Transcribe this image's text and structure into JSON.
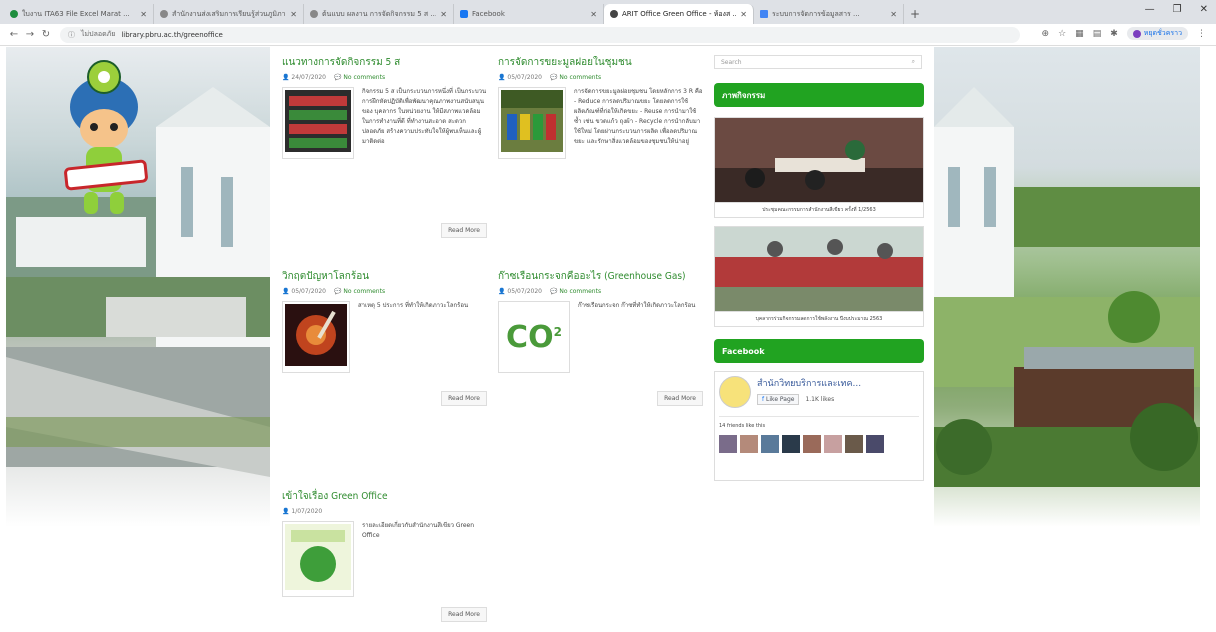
{
  "browser": {
    "tabs": [
      {
        "label": "ใบงาน ITA63 File Excel Marat ...",
        "active": false
      },
      {
        "label": "สำนักงานส่งเสริมการเรียนรู้ส่วนภูมิภาค ...",
        "active": false
      },
      {
        "label": "ต้นแบบ ผลงาน การจัดกิจกรรม 5 ส ...",
        "active": false
      },
      {
        "label": "Facebook",
        "active": false
      },
      {
        "label": "ARIT Office Green Office - ห้องส ...",
        "active": true
      },
      {
        "label": "ระบบการจัดการข้อมูลสาร ...",
        "active": false
      }
    ],
    "new_tab": "+",
    "url_site": "ไม่ปลอดภัย",
    "url": "library.pbru.ac.th/greenoffice",
    "profile": "หยุดชั่วคราว"
  },
  "posts": [
    {
      "title": "แนวทางการจัดกิจกรรม 5 ส",
      "date": "24/07/2020",
      "comments": "No comments",
      "excerpt": "กิจกรรม 5 ส เป็นกระบวนการหนึ่งที่ เป็นกระบวนการฝึกหัดปฏิบัติเพื่อพัฒนาคุณภาพงานสนับสนุนของ บุคลากร ในหน่วยงาน ให้มีสภาพแวดล้อมในการทำงานที่ดี ที่ทำงานสะอาด สะดวก ปลอดภัย สร้างความประทับใจให้ผู้พบเห็นและผู้มาติดต่อ",
      "read_more": "Read More"
    },
    {
      "title": "การจัดการขยะมูลฝอยในชุมชน",
      "date": "05/07/2020",
      "comments": "No comments",
      "excerpt": "การจัดการขยะมูลฝอยชุมชน โดยหลักการ 3 R คือ - Reduce การลดปริมาณขยะ โดยลดการใช้ผลิตภัณฑ์ที่ก่อให้เกิดขยะ - Reuse การนำมาใช้ซ้ำ เช่น ขวดแก้ว ถุงผ้า - Recycle การนำกลับมาใช้ใหม่ โดยผ่านกระบวนการผลิต เพื่อลดปริมาณขยะ และรักษาสิ่งแวดล้อมของชุมชนให้น่าอยู่",
      "read_more": "Read More"
    },
    {
      "title": "วิกฤตปัญหาโลกร้อน",
      "date": "05/07/2020",
      "comments": "No comments",
      "excerpt": "สาเหตุ 5 ประการ ที่ทำให้เกิดภาวะโลกร้อน",
      "read_more": "Read More"
    },
    {
      "title": "ก๊าซเรือนกระจกคืออะไร (Greenhouse Gas)",
      "date": "05/07/2020",
      "comments": "No comments",
      "excerpt": "ก๊าซเรือนกระจก ก๊าซที่ทำให้เกิดภาวะโลกร้อน",
      "read_more": "Read More"
    },
    {
      "title": "เข้าใจเรื่อง Green Office",
      "date": "1/07/2020",
      "comments": "",
      "excerpt": "รายละเอียดเกี่ยวกับสำนักงานสีเขียว Green Office",
      "read_more": "Read More"
    }
  ],
  "co2_text": "CO",
  "co2_sub": "2",
  "sidebar": {
    "search_placeholder": "Search",
    "activities_title": "ภาพกิจกรรม",
    "gallery": [
      {
        "caption": "ประชุมคณะกรรมการสำนักงานสีเขียว ครั้งที่ 1/2563"
      },
      {
        "caption": "บุคลากรร่วมกิจกรรมลดการใช้พลังงาน ปีงบประมาณ 2563"
      }
    ],
    "facebook_title": "Facebook",
    "fb_page_name": "สำนักวิทยบริการและเทค...",
    "fb_like": "Like Page",
    "fb_likes_count": "1.1K likes",
    "fb_friends": "14 friends like this"
  }
}
